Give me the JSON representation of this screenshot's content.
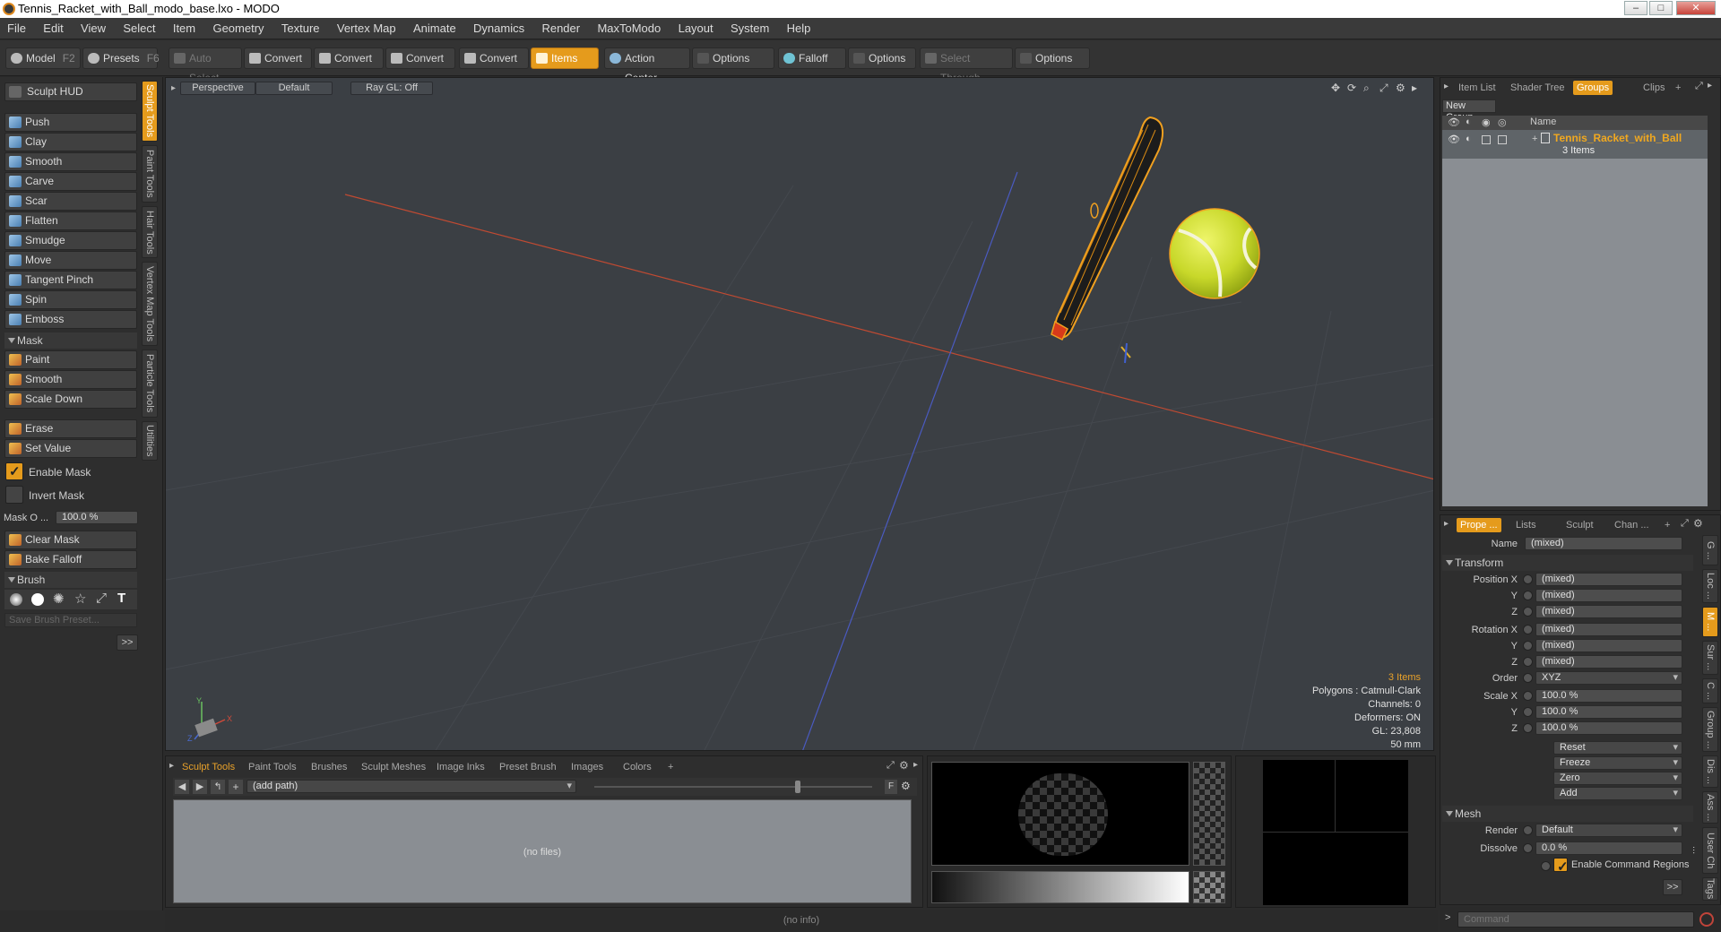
{
  "window": {
    "title": "Tennis_Racket_with_Ball_modo_base.lxo - MODO"
  },
  "menu": [
    "File",
    "Edit",
    "View",
    "Select",
    "Item",
    "Geometry",
    "Texture",
    "Vertex Map",
    "Animate",
    "Dynamics",
    "Render",
    "MaxToModo",
    "Layout",
    "System",
    "Help"
  ],
  "toolbar": {
    "model": "Model",
    "model_key": "F2",
    "presets": "Presets",
    "presets_key": "F6",
    "auto_select": "Auto Select",
    "convert1": "Convert",
    "convert2": "Convert",
    "convert3": "Convert",
    "convert4": "Convert",
    "items": "Items",
    "action_center": "Action Center",
    "options1": "Options",
    "falloff": "Falloff",
    "options2": "Options",
    "select_through": "Select Through",
    "options3": "Options"
  },
  "left": {
    "sculpt_hud": "Sculpt HUD",
    "tools": [
      "Push",
      "Clay",
      "Smooth",
      "Carve",
      "Scar",
      "Flatten",
      "Smudge",
      "Move",
      "Tangent Pinch",
      "Spin",
      "Emboss"
    ],
    "mask_section": "Mask",
    "mask_tools": [
      "Paint",
      "Smooth",
      "Scale Down"
    ],
    "erase": "Erase",
    "set_value": "Set Value",
    "enable_mask": "Enable Mask",
    "invert_mask": "Invert Mask",
    "mask_opacity_label": "Mask O ...",
    "mask_opacity_value": "100.0 %",
    "clear_mask": "Clear Mask",
    "bake_falloff": "Bake Falloff",
    "brush_section": "Brush",
    "save_brush_preset": "Save Brush Preset...",
    "expand": ">>",
    "vtabs": [
      "Sculpt Tools",
      "Paint Tools",
      "Hair Tools",
      "Vertex Map Tools",
      "Particle Tools",
      "Utilities"
    ]
  },
  "viewport": {
    "perspective": "Perspective",
    "default": "Default",
    "raygl": "Ray GL: Off",
    "info_items": "3 Items",
    "info_polygons": "Polygons : Catmull-Clark",
    "info_channels": "Channels: 0",
    "info_deformers": "Deformers: ON",
    "info_gl": "GL: 23,808",
    "info_scale": "50 mm",
    "axis_x": "X",
    "axis_y": "Y",
    "axis_z": "Z"
  },
  "bottom": {
    "tabs": [
      "Sculpt Tools",
      "Paint Tools",
      "Brushes",
      "Sculpt Meshes",
      "Image Inks",
      "Preset Brush",
      "Images",
      "Colors"
    ],
    "add_tab": "+",
    "path_placeholder": "(add path)",
    "f_button": "F",
    "no_files": "(no files)"
  },
  "right_top": {
    "tabs": [
      "Item List",
      "Shader Tree",
      "Groups",
      "Clips"
    ],
    "add_tab": "+",
    "new_group": "New Group",
    "col_name": "Name",
    "group_name": "Tennis_Racket_with_Ball",
    "group_count": "3 Items"
  },
  "right_bottom": {
    "tabs": [
      "Prope ...",
      "Lists",
      "Sculpt",
      "Chan ..."
    ],
    "add_tab": "+",
    "name_label": "Name",
    "name_value": "(mixed)",
    "transform_section": "Transform",
    "pos_x_label": "Position X",
    "pos_y_label": "Y",
    "pos_z_label": "Z",
    "pos_x": "(mixed)",
    "pos_y": "(mixed)",
    "pos_z": "(mixed)",
    "rot_x_label": "Rotation X",
    "rot_y_label": "Y",
    "rot_z_label": "Z",
    "rot_x": "(mixed)",
    "rot_y": "(mixed)",
    "rot_z": "(mixed)",
    "order_label": "Order",
    "order_value": "XYZ",
    "scale_x_label": "Scale X",
    "scale_y_label": "Y",
    "scale_z_label": "Z",
    "scale_x": "100.0 %",
    "scale_y": "100.0 %",
    "scale_z": "100.0 %",
    "reset": "Reset",
    "freeze": "Freeze",
    "zero": "Zero",
    "add": "Add",
    "mesh_section": "Mesh",
    "render_label": "Render",
    "render_value": "Default",
    "dissolve_label": "Dissolve",
    "dissolve_value": "0.0 %",
    "enable_command_regions": "Enable Command Regions",
    "expand": ">>",
    "side_tabs": [
      "G ...",
      "Loc ...",
      "M ...",
      "Sur ...",
      "C ...",
      "Group ...",
      "Dis ...",
      "Ass ...",
      "User Ch ...",
      "Tags"
    ]
  },
  "status": {
    "info": "(no info)",
    "command_placeholder": "Command"
  },
  "colors": {
    "accent": "#e59b1c",
    "viewport_bg": "#3b3f44",
    "panel_bg": "#2e2e2e"
  }
}
